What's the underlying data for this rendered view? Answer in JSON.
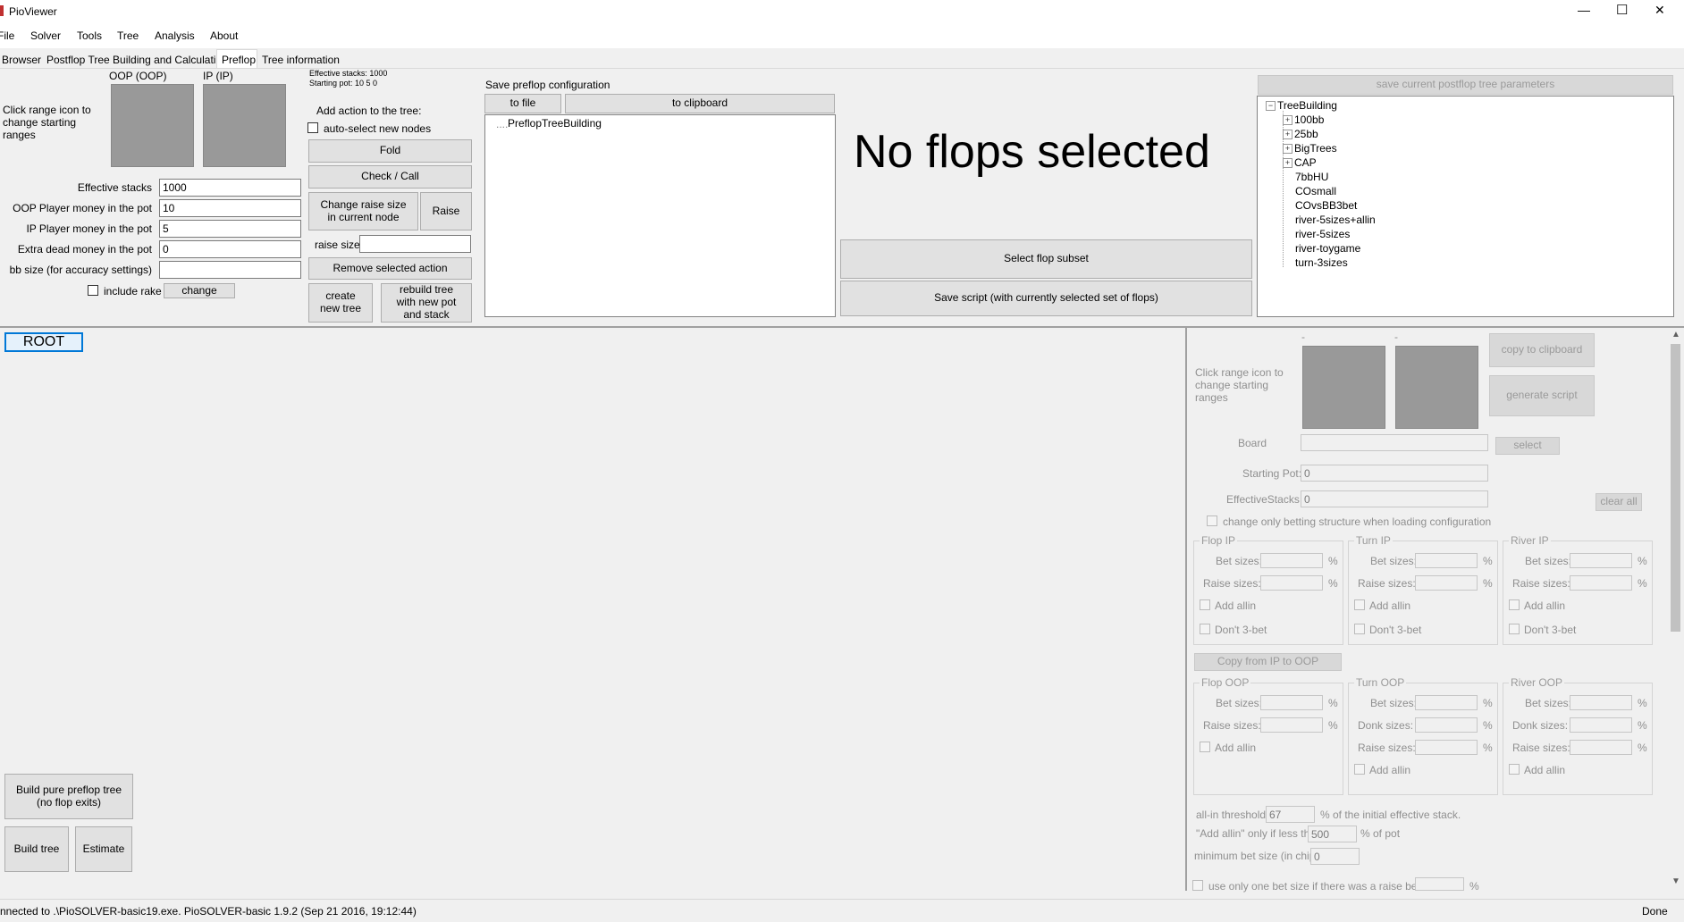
{
  "window": {
    "title": "PioViewer",
    "minimize": "—",
    "maximize": "☐",
    "close": "✕"
  },
  "menu": [
    "File",
    "Solver",
    "Tools",
    "Tree",
    "Analysis",
    "About"
  ],
  "tabs": [
    "Browser",
    "Postflop Tree Building and Calculations",
    "Preflop",
    "Tree information"
  ],
  "active_tab": "Preflop",
  "preflop": {
    "oop_label": "OOP (OOP)",
    "ip_label": "IP (IP)",
    "range_hint": "Click range icon to change starting ranges",
    "info_line1": "Effective stacks: 1000",
    "info_line2": "Starting pot: 10 5 0",
    "fields": [
      {
        "label": "Effective stacks",
        "value": "1000"
      },
      {
        "label": "OOP Player money in the pot",
        "value": "10"
      },
      {
        "label": "IP Player money in the pot",
        "value": "5"
      },
      {
        "label": "Extra dead money in the pot",
        "value": "0"
      },
      {
        "label": "bb size (for accuracy settings)",
        "value": ""
      }
    ],
    "include_rake": "include rake",
    "change": "change",
    "add_action": "Add action to the tree:",
    "auto_select": "auto-select new nodes",
    "fold": "Fold",
    "check_call": "Check / Call",
    "change_raise": "Change raise size in current node",
    "raise": "Raise",
    "raise_size": "raise size",
    "remove_action": "Remove selected action",
    "create_tree": "create new tree",
    "rebuild_tree": "rebuild tree with new pot and stack",
    "save_config": "Save preflop configuration",
    "to_file": "to file",
    "to_clipboard": "to clipboard",
    "config_item": "PreflopTreeBuilding",
    "no_flops": "No flops selected",
    "select_subset": "Select flop subset",
    "save_script": "Save script (with currently selected set of flops)",
    "save_postflop_params": "save current postflop tree parameters"
  },
  "tree_building": {
    "root": "TreeBuilding",
    "expandable": [
      "100bb",
      "25bb",
      "BigTrees",
      "CAP"
    ],
    "leaves": [
      "7bbHU",
      "COsmall",
      "COvsBB3bet",
      "river-5sizes+allin",
      "river-5sizes",
      "river-toygame",
      "turn-3sizes"
    ]
  },
  "tree_view": {
    "root_node": "ROOT",
    "build_pure": "Build pure preflop tree (no flop exits)",
    "build_tree": "Build tree",
    "estimate": "Estimate"
  },
  "right_panel": {
    "dash1": "-",
    "dash2": "-",
    "range_hint": "Click range icon to change starting ranges",
    "copy_clipboard": "copy to clipboard",
    "generate_script": "generate script",
    "board": "Board",
    "select": "select",
    "starting_pot": "Starting Pot:",
    "starting_pot_val": "0",
    "effective_stacks": "EffectiveStacks",
    "effective_stacks_val": "0",
    "clear_all": "clear all",
    "change_only": "change only betting structure when loading configuration",
    "flop_ip": "Flop IP",
    "turn_ip": "Turn IP",
    "river_ip": "River IP",
    "flop_oop": "Flop OOP",
    "turn_oop": "Turn OOP",
    "river_oop": "River OOP",
    "bet_sizes": "Bet sizes:",
    "raise_sizes": "Raise sizes:",
    "donk_sizes": "Donk sizes:",
    "add_allin": "Add allin",
    "dont_3bet": "Don't 3-bet",
    "pct": "%",
    "copy_ip_oop": "Copy from IP to OOP",
    "allin_threshold": "all-in threshold:",
    "allin_threshold_val": "67",
    "allin_threshold_suffix": "% of the initial effective stack.",
    "add_allin_less": "\"Add allin\" only if less than",
    "add_allin_less_val": "500",
    "add_allin_less_suffix": "% of pot",
    "min_bet": "minimum bet size (in chips):",
    "min_bet_val": "0",
    "one_bet": "use only one bet size if there was a raise before"
  },
  "status": {
    "left": "nnected to .\\PioSOLVER-basic19.exe. PioSOLVER-basic 1.9.2 (Sep 21 2016, 19:12:44)",
    "right": "Done"
  }
}
